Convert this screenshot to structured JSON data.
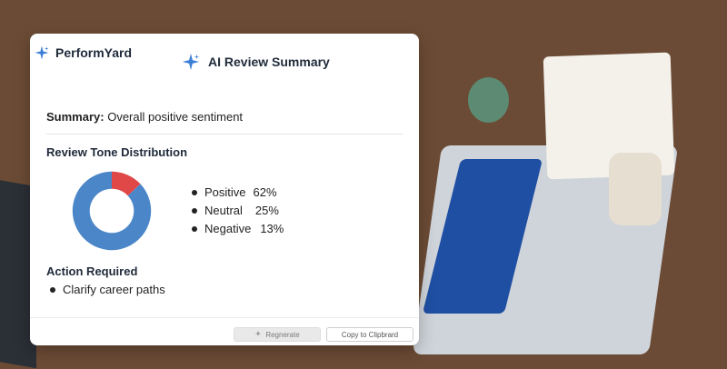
{
  "brand": {
    "name": "PerformYard"
  },
  "header": {
    "title": "AI Review Summary"
  },
  "summary": {
    "label": "Summary:",
    "text": "Overall positive sentiment"
  },
  "tone_distribution": {
    "title": "Review Tone Distribution",
    "items": [
      {
        "label": "Positive",
        "value": "62%"
      },
      {
        "label": "Neutral",
        "value": "25%"
      },
      {
        "label": "Negative",
        "value": "13%"
      }
    ]
  },
  "chart_data": {
    "type": "pie",
    "categories": [
      "Positive",
      "Neutral",
      "Negative"
    ],
    "values": [
      62,
      25,
      13
    ],
    "colors": [
      "#4a86c8",
      "#4a86c8",
      "#e04848"
    ]
  },
  "actions": {
    "title": "Action Required",
    "items": [
      {
        "label": "Clarify career paths"
      }
    ]
  },
  "footer": {
    "regenerate_label": "Regnerate",
    "copy_label": "Copy to Clipbrard"
  },
  "colors": {
    "accent": "#4a86c8",
    "negative": "#e04848",
    "sparkle": "#3b7ed6"
  },
  "icons": {
    "brand": "sparkle-icon",
    "header": "sparkle-icon",
    "regenerate": "sparkle-icon"
  }
}
